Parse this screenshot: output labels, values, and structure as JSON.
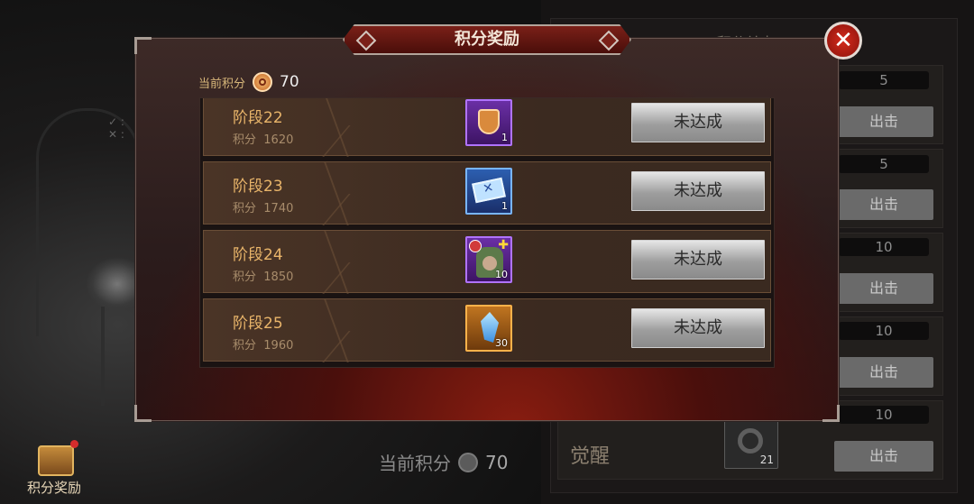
{
  "modal": {
    "title": "积分奖励",
    "current_points_label": "当前积分",
    "current_points_value": "70"
  },
  "rewards": [
    {
      "stage": "阶段22",
      "points_label": "积分",
      "points": "1620",
      "item": "shield-item-icon",
      "item_qty": "1",
      "rarity": "purple",
      "status": "未达成"
    },
    {
      "stage": "阶段23",
      "points_label": "积分",
      "points": "1740",
      "item": "ticket-item-icon",
      "item_qty": "1",
      "rarity": "blue",
      "status": "未达成"
    },
    {
      "stage": "阶段24",
      "points_label": "积分",
      "points": "1850",
      "item": "hero-shard-item-icon",
      "item_qty": "10",
      "rarity": "purple",
      "status": "未达成"
    },
    {
      "stage": "阶段25",
      "points_label": "积分",
      "points": "1960",
      "item": "crystal-item-icon",
      "item_qty": "30",
      "rarity": "orange",
      "status": "未达成"
    }
  ],
  "background": {
    "right_title": "积分关卡",
    "counts": [
      "5",
      "5",
      "10",
      "10",
      "10"
    ],
    "go_buttons": [
      "出击",
      "出击",
      "出击",
      "出击",
      "出击"
    ],
    "awaken_label": "觉醒",
    "awaken_item_qty": "21",
    "bottom_points_label": "当前积分",
    "bottom_points_value": "70"
  },
  "reward_button": {
    "label": "积分奖励"
  },
  "colors": {
    "accent_gold": "#e9b56a",
    "title_red": "#7a2018",
    "close_red": "#d52a1c"
  }
}
